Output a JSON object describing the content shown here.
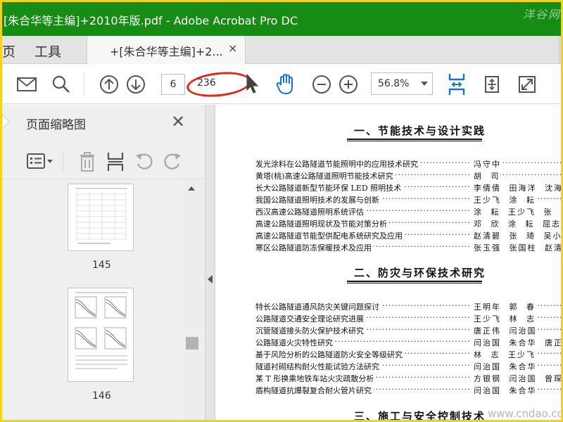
{
  "window": {
    "title": "[朱合华等主编]+2010年版.pdf - Adobe Acrobat Pro DC",
    "watermark": "洋谷网"
  },
  "tabs": {
    "home": "页",
    "tools": "工具",
    "document_tab": "+[朱合华等主编]+2...",
    "close": "×"
  },
  "toolbar": {
    "current_page": "6",
    "total_pages": "236",
    "zoom": "56.8%",
    "icons": [
      "mail-icon",
      "search-icon",
      "prev-page-icon",
      "next-page-icon",
      "cursor-icon",
      "hand-icon",
      "zoom-out-icon",
      "zoom-in-icon",
      "fit-page-icon",
      "scroll-mode-icon",
      "fullscreen-icon"
    ]
  },
  "left_panel": {
    "title": "页面缩略图",
    "close": "✕",
    "thumbnails": [
      {
        "label": "145"
      },
      {
        "label": "146"
      }
    ]
  },
  "document": {
    "sections": [
      {
        "title": "一、节能技术与设计实践",
        "entries": [
          {
            "title": "发光涂料在公路隧道节能照明中的应用技术研究",
            "authors": "冯守中"
          },
          {
            "title": "黄塔(桃)高速公路隧道照明节能技术研究",
            "authors": "胡 司"
          },
          {
            "title": "长大公路隧道新型节能环保 LED 照明技术",
            "authors": "李倩倩 田海洋 沈海平"
          },
          {
            "title": "我国公路隧道照明技术的发展与创新",
            "authors": "王少飞 涂 耘"
          },
          {
            "title": "西汉高速公路隧道照明系统评估",
            "authors": "涂 耘 王少飞 张 琦 等"
          },
          {
            "title": "高速公路隧道照明现状及节能对策分析",
            "authors": "邓 欣 涂 耘 屈志豪"
          },
          {
            "title": "高速公路隧道节能型供配电系统研究及应用",
            "authors": "赵清碧 张 琦 吴小丽"
          },
          {
            "title": "寒区公路隧道防冻保暖技术及应用",
            "authors": "张玉强 张国柱 赵清平"
          }
        ]
      },
      {
        "title": "二、防灾与环保技术研究",
        "entries": [
          {
            "title": "特长公路隧道通风防灾关键问题探讨",
            "authors": "王明年 郭 春"
          },
          {
            "title": "公路隧道交通安全理论研究进展",
            "authors": "王少飞 林 志"
          },
          {
            "title": "沉管隧道接头防火保护技术研究",
            "authors": "唐正伟 闫治国"
          },
          {
            "title": "公路隧道火灾特性研究",
            "authors": "闫治国 朱合华 唐正伟"
          },
          {
            "title": "基于风险分析的公路隧道防火安全等级研究",
            "authors": "林 志 王少飞"
          },
          {
            "title": "隧道衬砌结构耐火性能试验方法研究",
            "authors": "闫治国 朱合华"
          },
          {
            "title": "某 T 形换乘地铁车站火灾疏散分析",
            "authors": "方银钢 闫治国 曾琛超"
          },
          {
            "title": "盾构隧道抗爆裂复合耐火管片研究",
            "authors": "闫治国 朱合华"
          }
        ]
      },
      {
        "title": "三、施工与安全控制技术",
        "entries": []
      }
    ],
    "watermark": "www.cndao.com"
  }
}
